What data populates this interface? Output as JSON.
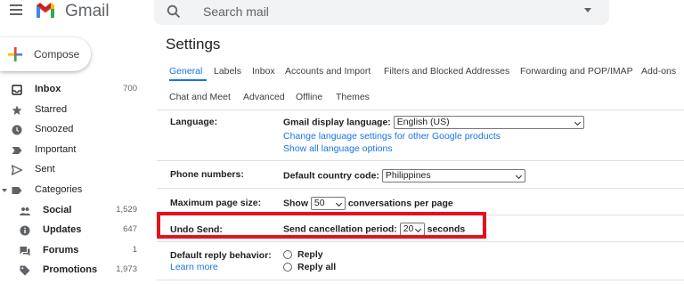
{
  "header": {
    "brand": "Gmail",
    "search_placeholder": "Search mail"
  },
  "compose": {
    "label": "Compose"
  },
  "nav": {
    "items": [
      {
        "label": "Inbox",
        "count": "700",
        "icon": "inbox-icon",
        "bold": true
      },
      {
        "label": "Starred",
        "count": "",
        "icon": "star-icon"
      },
      {
        "label": "Snoozed",
        "count": "",
        "icon": "clock-icon"
      },
      {
        "label": "Important",
        "count": "",
        "icon": "important-icon"
      },
      {
        "label": "Sent",
        "count": "",
        "icon": "send-icon"
      },
      {
        "label": "Categories",
        "count": "",
        "icon": "label-icon"
      }
    ],
    "categories": [
      {
        "label": "Social",
        "count": "1,529",
        "icon": "people-icon"
      },
      {
        "label": "Updates",
        "count": "647",
        "icon": "info-icon"
      },
      {
        "label": "Forums",
        "count": "1",
        "icon": "forum-icon"
      },
      {
        "label": "Promotions",
        "count": "1,973",
        "icon": "tag-icon"
      }
    ]
  },
  "settings": {
    "title": "Settings",
    "tabs_row1": [
      "General",
      "Labels",
      "Inbox",
      "Accounts and Import",
      "Filters and Blocked Addresses",
      "Forwarding and POP/IMAP",
      "Add-ons"
    ],
    "tabs_row2": [
      "Chat and Meet",
      "Advanced",
      "Offline",
      "Themes"
    ],
    "active_tab": "General",
    "language": {
      "label": "Language:",
      "display_label": "Gmail display language:",
      "display_value": "English (US)",
      "link1": "Change language settings for other Google products",
      "link2": "Show all language options"
    },
    "phone": {
      "label": "Phone numbers:",
      "country_label": "Default country code:",
      "country_value": "Philippines"
    },
    "page_size": {
      "label": "Maximum page size:",
      "show": "Show",
      "value": "50",
      "suffix": "conversations per page"
    },
    "undo_send": {
      "label": "Undo Send:",
      "period_label": "Send cancellation period:",
      "value": "20",
      "suffix": "seconds"
    },
    "reply": {
      "label": "Default reply behavior:",
      "learn_more": "Learn more",
      "option1": "Reply",
      "option2": "Reply all"
    }
  },
  "colors": {
    "accent": "#1a73e8",
    "highlight": "#e4121f"
  }
}
